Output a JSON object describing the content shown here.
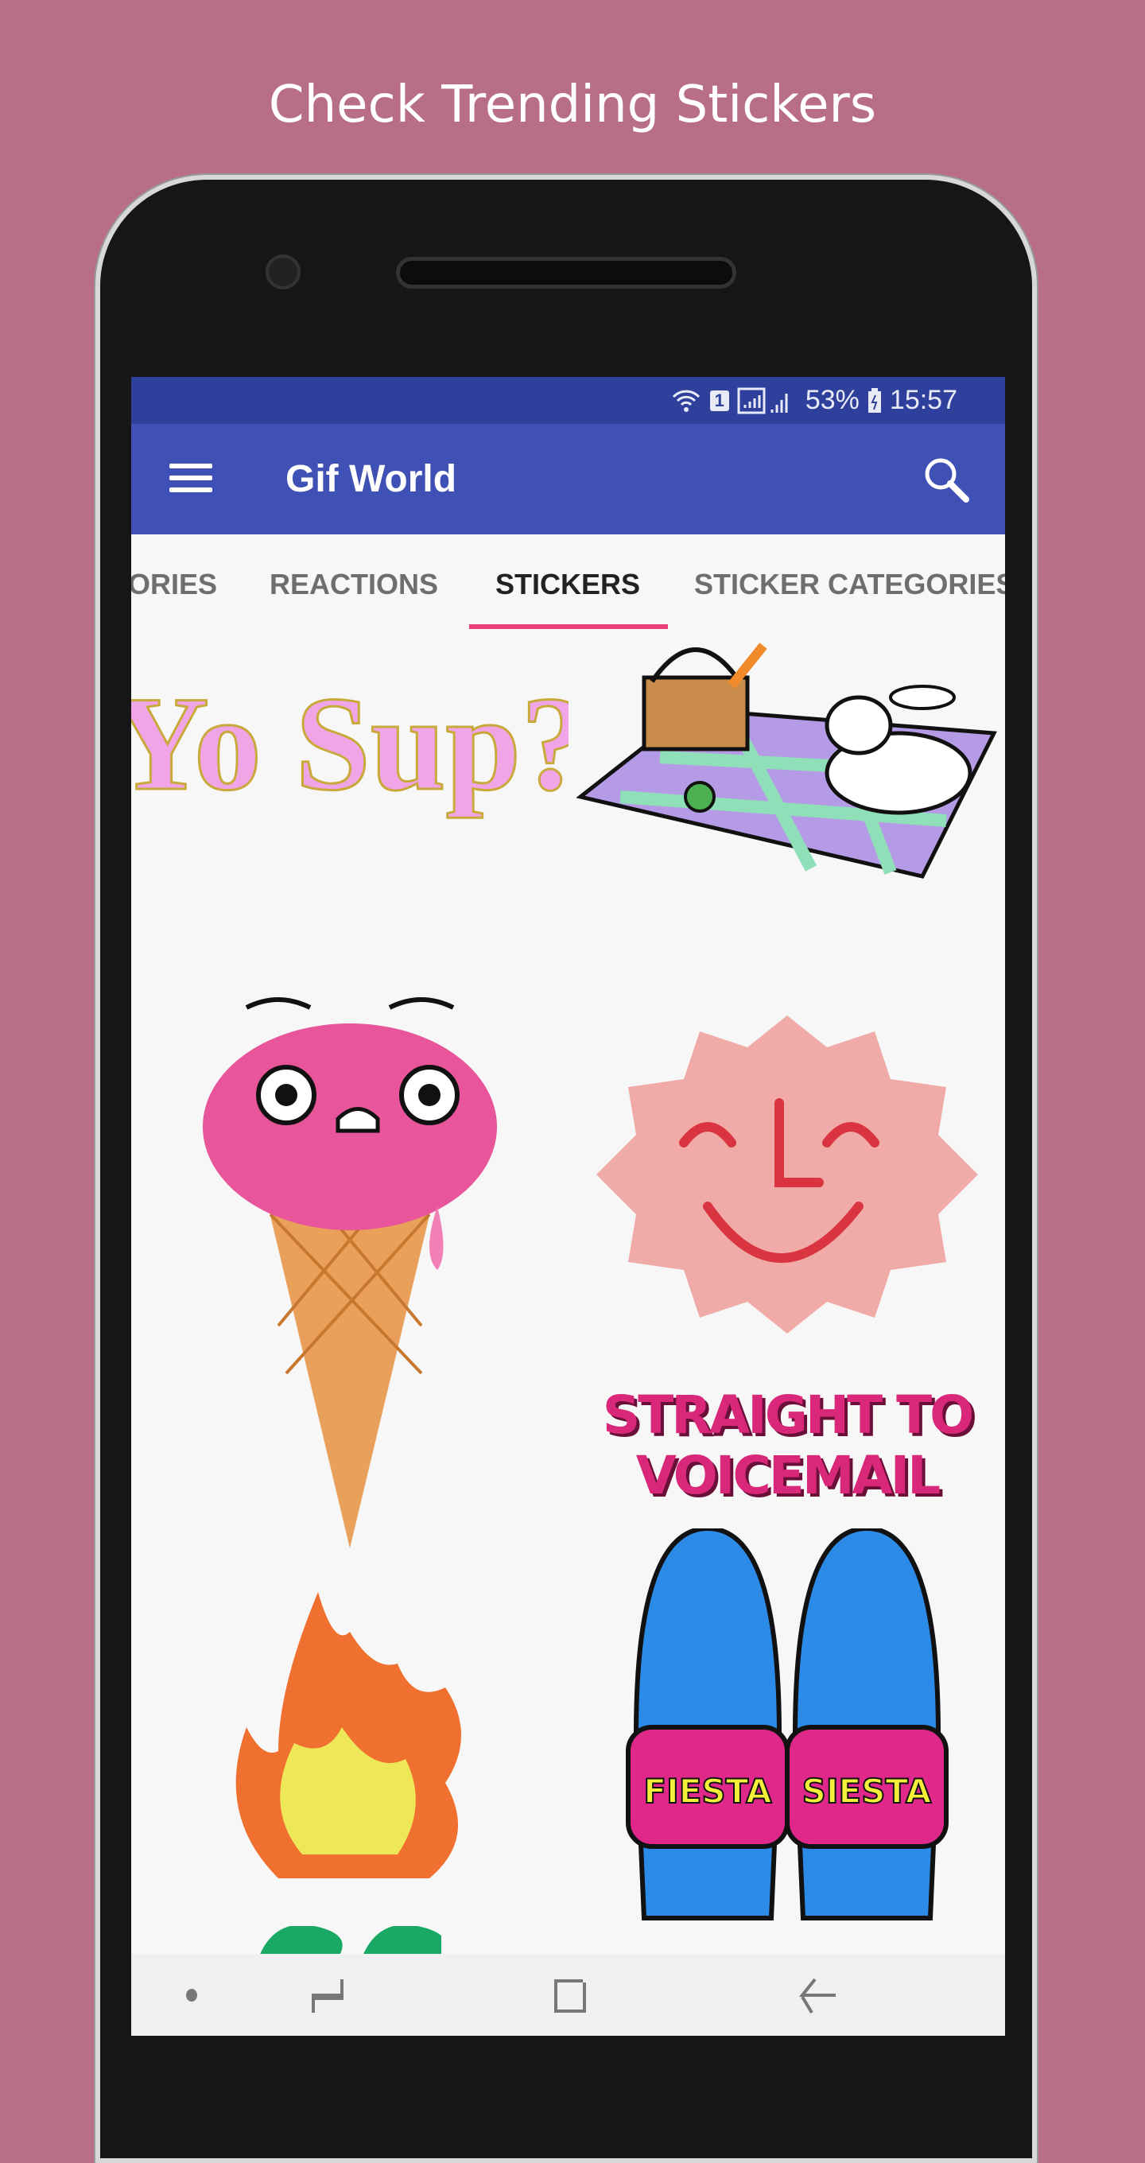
{
  "caption": "Check Trending Stickers",
  "status_bar": {
    "battery": "53%",
    "time": "15:57",
    "sim": "1"
  },
  "app_bar": {
    "title": "Gif World",
    "menu_icon": "hamburger-icon",
    "search_icon": "search-icon"
  },
  "tabs": [
    {
      "label": "ORIES"
    },
    {
      "label": "REACTIONS"
    },
    {
      "label": "STICKERS",
      "active": true
    },
    {
      "label": "STICKER CATEGORIES"
    }
  ],
  "colors": {
    "background": "#b86d88",
    "status_bar": "#2f3f9c",
    "app_bar": "#3f51b5",
    "tab_indicator": "#ec407a"
  },
  "stickers": {
    "yo_sup": "Yo Sup?",
    "voicemail_1": "STRAIGHT TO",
    "voicemail_2": "VOICEMAIL",
    "slipper_left": "FIESTA",
    "slipper_right": "SIESTA"
  },
  "nav": [
    "dot-icon",
    "recent-apps-icon",
    "home-icon",
    "back-icon"
  ]
}
